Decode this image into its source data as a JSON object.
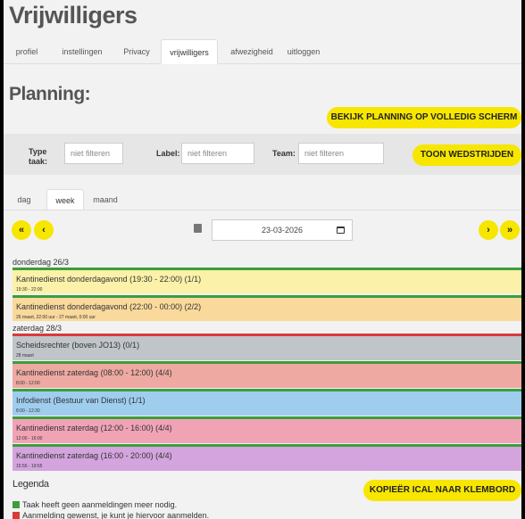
{
  "app": {
    "title": "Vrijwilligers"
  },
  "tabs": [
    {
      "label": "profiel"
    },
    {
      "label": "instellingen"
    },
    {
      "label": "Privacy"
    },
    {
      "label": "vrijwilligers"
    },
    {
      "label": "afwezigheid"
    },
    {
      "label": "uitloggen"
    }
  ],
  "active_tab": "vrijwilligers",
  "planning": {
    "title": "Planning:",
    "fullscreen_label": "BEKIJK PLANNING OP VOLLEDIG SCHERM"
  },
  "filters": {
    "type_label": "Type taak:",
    "type_placeholder": "niet filteren",
    "label_label": "Label:",
    "label_placeholder": "niet filteren",
    "team_label": "Team:",
    "team_placeholder": "niet filteren",
    "show_matches_label": "TOON WEDSTRIJDEN"
  },
  "view_tabs": [
    {
      "label": "dag"
    },
    {
      "label": "week"
    },
    {
      "label": "maand"
    }
  ],
  "active_view": "week",
  "nav": {
    "first": "«",
    "prev": "‹",
    "next": "›",
    "last": "»",
    "date": "23-03-2026"
  },
  "days": [
    {
      "label": "donderdag 26/3",
      "tasks": [
        {
          "name": "Kantinedienst donderdagavond (19:30 - 22:00) (1/1)",
          "time": "19:30 - 22:00",
          "color": "#fbf1a8",
          "bar": "#3a9f3a"
        },
        {
          "name": "Kantinedienst donderdagavond (22:00 - 00:00) (2/2)",
          "time": "26 maart, 22:00 uur - 27 maart, 0:00 uur",
          "color": "#f9d99c",
          "bar": "#3a9f3a"
        }
      ]
    },
    {
      "label": "zaterdag 28/3",
      "tasks": [
        {
          "name": "Scheidsrechter (boven JO13) (0/1)",
          "time": "28 maart",
          "color": "#bfc5c9",
          "bar": "#d93a3a"
        },
        {
          "name": "Kantinedienst zaterdag (08:00 - 12:00) (4/4)",
          "time": "8:00 - 12:00",
          "color": "#eda9a2",
          "bar": "#3a9f3a"
        },
        {
          "name": "Infodienst (Bestuur van Dienst) (1/1)",
          "time": "8:00 - 12:30",
          "color": "#9fcdee",
          "bar": "#3a9f3a"
        },
        {
          "name": "Kantinedienst zaterdag (12:00 - 16:00) (4/4)",
          "time": "12:00 - 16:00",
          "color": "#f1a3b6",
          "bar": "#3a9f3a"
        },
        {
          "name": "Kantinedienst zaterdag (16:00 - 20:00) (4/4)",
          "time": "15:55 - 19:55",
          "color": "#d3a4dd",
          "bar": "#3a9f3a"
        }
      ]
    }
  ],
  "legend": {
    "title": "Legenda",
    "copy_ical_label": "KOPIEËR ICAL NAAR KLEMBORD",
    "items": [
      {
        "text": "Taak heeft geen aanmeldingen meer nodig.",
        "color": "#3a9f3a"
      },
      {
        "text": "Aanmelding gewenst, je kunt je hiervoor aanmelden.",
        "color": "#d93a3a"
      }
    ]
  }
}
